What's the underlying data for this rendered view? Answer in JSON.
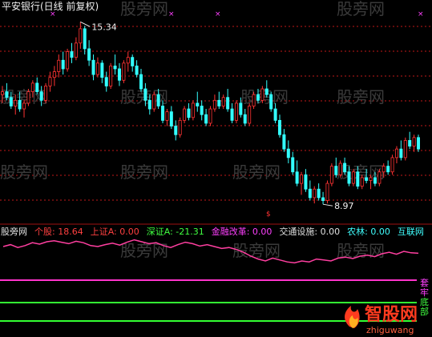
{
  "title": "平安银行(日线 前复权)",
  "watermark": "股旁网",
  "chart_data": [
    {
      "type": "candlestick",
      "panel": "price",
      "title": "平安银行(日线 前复权)",
      "annotations": [
        {
          "label": "15.34",
          "x": 58,
          "y": 15.34
        },
        {
          "label": "8.97",
          "x": 378,
          "y": 8.97
        }
      ],
      "x_count": 520,
      "x_start": 0,
      "x_step": 3,
      "ohlc": [
        [
          12.8,
          13.1,
          12.5,
          12.9
        ],
        [
          12.9,
          13.2,
          12.6,
          12.7
        ],
        [
          12.7,
          12.9,
          12.3,
          12.4
        ],
        [
          12.4,
          12.8,
          12.1,
          12.6
        ],
        [
          12.6,
          12.9,
          12.2,
          12.3
        ],
        [
          12.3,
          12.6,
          12.0,
          12.5
        ],
        [
          12.5,
          13.0,
          12.4,
          12.9
        ],
        [
          12.9,
          13.3,
          12.7,
          13.2
        ],
        [
          13.2,
          13.4,
          12.8,
          12.9
        ],
        [
          12.9,
          13.1,
          12.4,
          12.6
        ],
        [
          12.6,
          13.2,
          12.5,
          13.1
        ],
        [
          13.1,
          13.6,
          12.9,
          13.4
        ],
        [
          13.4,
          13.8,
          13.1,
          13.6
        ],
        [
          13.6,
          14.2,
          13.4,
          14.0
        ],
        [
          14.0,
          14.3,
          13.5,
          13.7
        ],
        [
          13.7,
          14.4,
          13.6,
          14.3
        ],
        [
          14.3,
          14.6,
          13.9,
          14.1
        ],
        [
          14.1,
          14.8,
          14.0,
          14.6
        ],
        [
          14.6,
          15.34,
          14.4,
          15.1
        ],
        [
          15.1,
          15.2,
          14.2,
          14.4
        ],
        [
          14.4,
          14.7,
          13.8,
          14.0
        ],
        [
          14.0,
          14.2,
          13.3,
          13.5
        ],
        [
          13.5,
          14.1,
          13.4,
          13.9
        ],
        [
          13.9,
          14.0,
          13.2,
          13.4
        ],
        [
          13.4,
          13.6,
          12.9,
          13.1
        ],
        [
          13.1,
          13.9,
          13.0,
          13.8
        ],
        [
          13.8,
          14.2,
          13.5,
          13.7
        ],
        [
          13.7,
          13.9,
          13.1,
          13.3
        ],
        [
          13.3,
          14.0,
          13.2,
          13.9
        ],
        [
          13.9,
          14.3,
          13.6,
          14.1
        ],
        [
          14.1,
          14.2,
          13.6,
          13.8
        ],
        [
          13.8,
          14.0,
          13.4,
          13.5
        ],
        [
          13.5,
          13.7,
          12.9,
          13.0
        ],
        [
          13.0,
          13.2,
          12.4,
          12.6
        ],
        [
          12.6,
          12.8,
          12.1,
          12.3
        ],
        [
          12.3,
          12.9,
          12.2,
          12.8
        ],
        [
          12.8,
          13.0,
          12.3,
          12.4
        ],
        [
          12.4,
          12.6,
          11.8,
          11.9
        ],
        [
          11.9,
          12.3,
          11.7,
          12.2
        ],
        [
          12.2,
          12.4,
          11.6,
          11.7
        ],
        [
          11.7,
          11.9,
          11.2,
          11.4
        ],
        [
          11.4,
          12.0,
          11.3,
          11.9
        ],
        [
          11.9,
          12.4,
          11.8,
          12.3
        ],
        [
          12.3,
          12.5,
          11.9,
          12.0
        ],
        [
          12.0,
          12.6,
          11.9,
          12.5
        ],
        [
          12.5,
          12.9,
          12.2,
          12.4
        ],
        [
          12.4,
          12.6,
          11.9,
          12.1
        ],
        [
          12.1,
          12.3,
          11.7,
          11.8
        ],
        [
          11.8,
          12.4,
          11.7,
          12.3
        ],
        [
          12.3,
          12.8,
          12.2,
          12.6
        ],
        [
          12.6,
          12.9,
          12.3,
          12.4
        ],
        [
          12.4,
          12.8,
          12.3,
          12.7
        ],
        [
          12.7,
          13.0,
          12.2,
          12.3
        ],
        [
          12.3,
          12.5,
          11.8,
          11.9
        ],
        [
          11.9,
          12.6,
          11.8,
          12.5
        ],
        [
          12.5,
          12.7,
          12.0,
          12.1
        ],
        [
          12.1,
          12.3,
          11.7,
          11.8
        ],
        [
          11.8,
          12.5,
          11.7,
          12.4
        ],
        [
          12.4,
          12.9,
          12.3,
          12.8
        ],
        [
          12.8,
          13.0,
          12.5,
          12.6
        ],
        [
          12.6,
          13.1,
          12.5,
          13.0
        ],
        [
          13.0,
          13.3,
          12.7,
          12.8
        ],
        [
          12.8,
          12.9,
          12.2,
          12.3
        ],
        [
          12.3,
          12.5,
          11.8,
          11.9
        ],
        [
          11.9,
          12.1,
          11.3,
          11.4
        ],
        [
          11.4,
          11.6,
          10.8,
          10.9
        ],
        [
          10.9,
          11.2,
          10.4,
          10.6
        ],
        [
          10.6,
          10.8,
          10.0,
          10.1
        ],
        [
          10.1,
          10.5,
          9.6,
          9.7
        ],
        [
          9.7,
          10.1,
          9.3,
          10.0
        ],
        [
          10.0,
          10.2,
          9.4,
          9.5
        ],
        [
          9.5,
          9.8,
          9.1,
          9.2
        ],
        [
          9.2,
          9.6,
          9.0,
          9.5
        ],
        [
          9.5,
          9.7,
          9.1,
          9.2
        ],
        [
          9.2,
          9.4,
          8.97,
          9.1
        ],
        [
          9.1,
          9.8,
          9.0,
          9.7
        ],
        [
          9.7,
          10.4,
          9.6,
          10.3
        ],
        [
          10.3,
          10.6,
          9.9,
          10.0
        ],
        [
          10.0,
          10.5,
          9.9,
          10.4
        ],
        [
          10.4,
          10.6,
          10.0,
          10.1
        ],
        [
          10.1,
          10.3,
          9.6,
          9.7
        ],
        [
          9.7,
          10.2,
          9.6,
          10.1
        ],
        [
          10.1,
          10.3,
          9.5,
          9.6
        ],
        [
          9.6,
          10.0,
          9.5,
          9.9
        ],
        [
          9.9,
          10.2,
          9.7,
          9.8
        ],
        [
          9.8,
          10.0,
          9.5,
          9.9
        ],
        [
          9.9,
          10.1,
          9.6,
          9.7
        ],
        [
          9.7,
          10.2,
          9.6,
          10.1
        ],
        [
          10.1,
          10.4,
          9.9,
          10.3
        ],
        [
          10.3,
          10.5,
          10.0,
          10.1
        ],
        [
          10.1,
          10.7,
          10.0,
          10.6
        ],
        [
          10.6,
          11.0,
          10.4,
          10.9
        ],
        [
          10.9,
          11.2,
          10.5,
          10.6
        ],
        [
          10.6,
          11.3,
          10.5,
          11.2
        ],
        [
          11.2,
          11.5,
          10.9,
          11.0
        ],
        [
          11.0,
          11.4,
          10.8,
          11.3
        ],
        [
          11.3,
          11.4,
          10.8,
          10.9
        ]
      ]
    },
    {
      "type": "line",
      "panel": "indicator",
      "legend": [
        {
          "name": "股旁网",
          "value": "",
          "color": "#e0e0e0"
        },
        {
          "name": "个股",
          "value": "18.64",
          "color": "#ff4040"
        },
        {
          "name": "上证A",
          "value": "0.00",
          "color": "#ff4040"
        },
        {
          "name": "深证A",
          "value": "-21.31",
          "color": "#40ff40"
        },
        {
          "name": "金融改革",
          "value": "0.00",
          "color": "#ff40ff"
        },
        {
          "name": "交通设施",
          "value": "0.00",
          "color": "#e0e0e0"
        },
        {
          "name": "农林",
          "value": "0.00",
          "color": "#40ffff"
        },
        {
          "name": "互联网",
          "value": "",
          "color": "#40ffff"
        }
      ],
      "series": [
        {
          "name": "个股",
          "color": "#ff3fa0",
          "values": [
            70,
            74,
            68,
            72,
            78,
            75,
            80,
            82,
            79,
            76,
            81,
            78,
            72,
            70,
            74,
            77,
            73,
            79,
            84,
            80,
            76,
            78,
            72,
            68,
            74,
            79,
            76,
            71,
            74,
            70,
            66,
            68,
            64,
            58,
            50,
            44,
            40,
            46,
            42,
            38,
            36,
            40,
            38,
            44,
            42,
            40,
            46,
            48,
            45,
            50,
            52,
            49,
            55,
            58,
            54,
            60,
            57,
            56
          ]
        }
      ],
      "horizontal_lines": [
        {
          "name": "magenta-line",
          "color": "#ff33cc"
        },
        {
          "name": "green-line-upper",
          "color": "#33ff33"
        },
        {
          "name": "green-line-lower",
          "color": "#33ff33"
        }
      ],
      "right_labels": [
        "套",
        "牢",
        "底",
        "部"
      ]
    }
  ],
  "colors": {
    "up": "#ff3333",
    "down": "#33ffff",
    "grid": "#c01818",
    "bg": "#000000"
  },
  "brand": "智股网",
  "brand_url": "zhiguwang"
}
